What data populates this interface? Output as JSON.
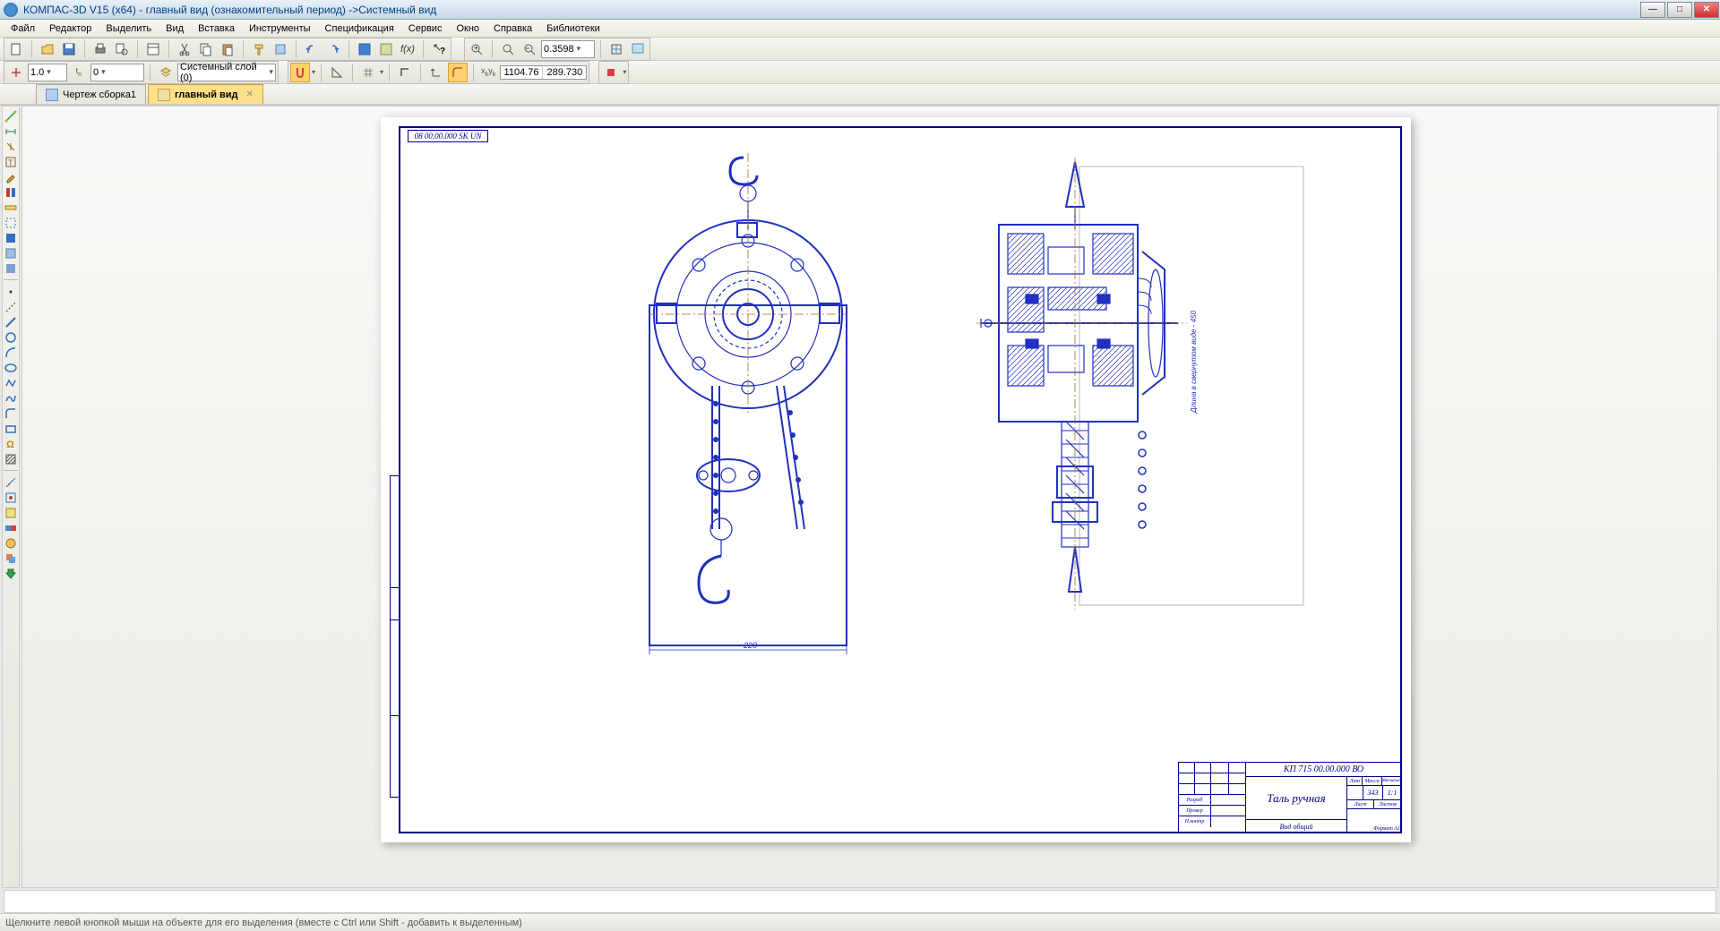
{
  "window": {
    "title": "КОМПАС-3D V15 (x64) - главный вид (ознакомительный период) ->Системный вид"
  },
  "menu": {
    "file": "Файл",
    "editor": "Редактор",
    "select": "Выделить",
    "view": "Вид",
    "insert": "Вставка",
    "tools": "Инструменты",
    "spec": "Спецификация",
    "service": "Сервис",
    "window": "Окно",
    "help": "Справка",
    "libraries": "Библиотеки"
  },
  "toolbar1": {
    "zoom_value": "0.3598"
  },
  "toolbar2": {
    "scale_value": "1.0",
    "step_value": "0",
    "layer_value": "Системный слой (0)",
    "coord_x": "1104.76",
    "coord_y": "289.730"
  },
  "tabs": {
    "tab1": "Чертеж сборка1",
    "tab2": "главный вид"
  },
  "drawing": {
    "sheet_code": "08 00.00.000 SK UN",
    "title_block": {
      "code": "КП 715 00.00.000 ВО",
      "name": "Таль ручная",
      "subtitle": "Вид общий",
      "mass": "343",
      "scale_hdr": "Масштаб",
      "lit": "Лит",
      "mass_hdr": "Масса",
      "sheet": "Лист",
      "sheets": "Листов",
      "format": "Формат   A1",
      "scale_val": "1:1"
    },
    "dim_note": "220",
    "side_note": "Длина в свернутом виде - 450"
  },
  "status": {
    "message": "Щелкните левой кнопкой мыши на объекте для его выделения (вместе с Ctrl или Shift - добавить к выделенным)"
  }
}
